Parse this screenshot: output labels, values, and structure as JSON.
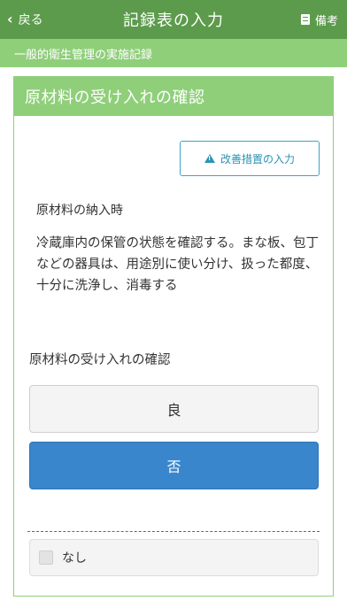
{
  "header": {
    "back_label": "戻る",
    "title": "記録表の入力",
    "notes_label": "備考"
  },
  "subheader": {
    "text": "一般的衛生管理の実施記録"
  },
  "card": {
    "title": "原材料の受け入れの確認",
    "improve_button_label": "改善措置の入力",
    "timing": "原材料の納入時",
    "description": "冷蔵庫内の保管の状態を確認する。まな板、包丁などの器具は、用途別に使い分け、扱った都度、十分に洗浄し、消毒する",
    "question": "原材料の受け入れの確認",
    "options": [
      {
        "label": "良",
        "selected": false
      },
      {
        "label": "否",
        "selected": true
      }
    ],
    "none_checkbox": {
      "label": "なし",
      "checked": false
    }
  },
  "colors": {
    "header_bg": "#5c9b4c",
    "accent_green": "#8fcf7a",
    "selected_blue": "#3a86cc",
    "improve_teal": "#2a93b3"
  },
  "icons": {
    "back": "chevron-left-icon",
    "notes": "notes-icon",
    "warning": "warning-icon",
    "checkbox": "checkbox-icon"
  }
}
